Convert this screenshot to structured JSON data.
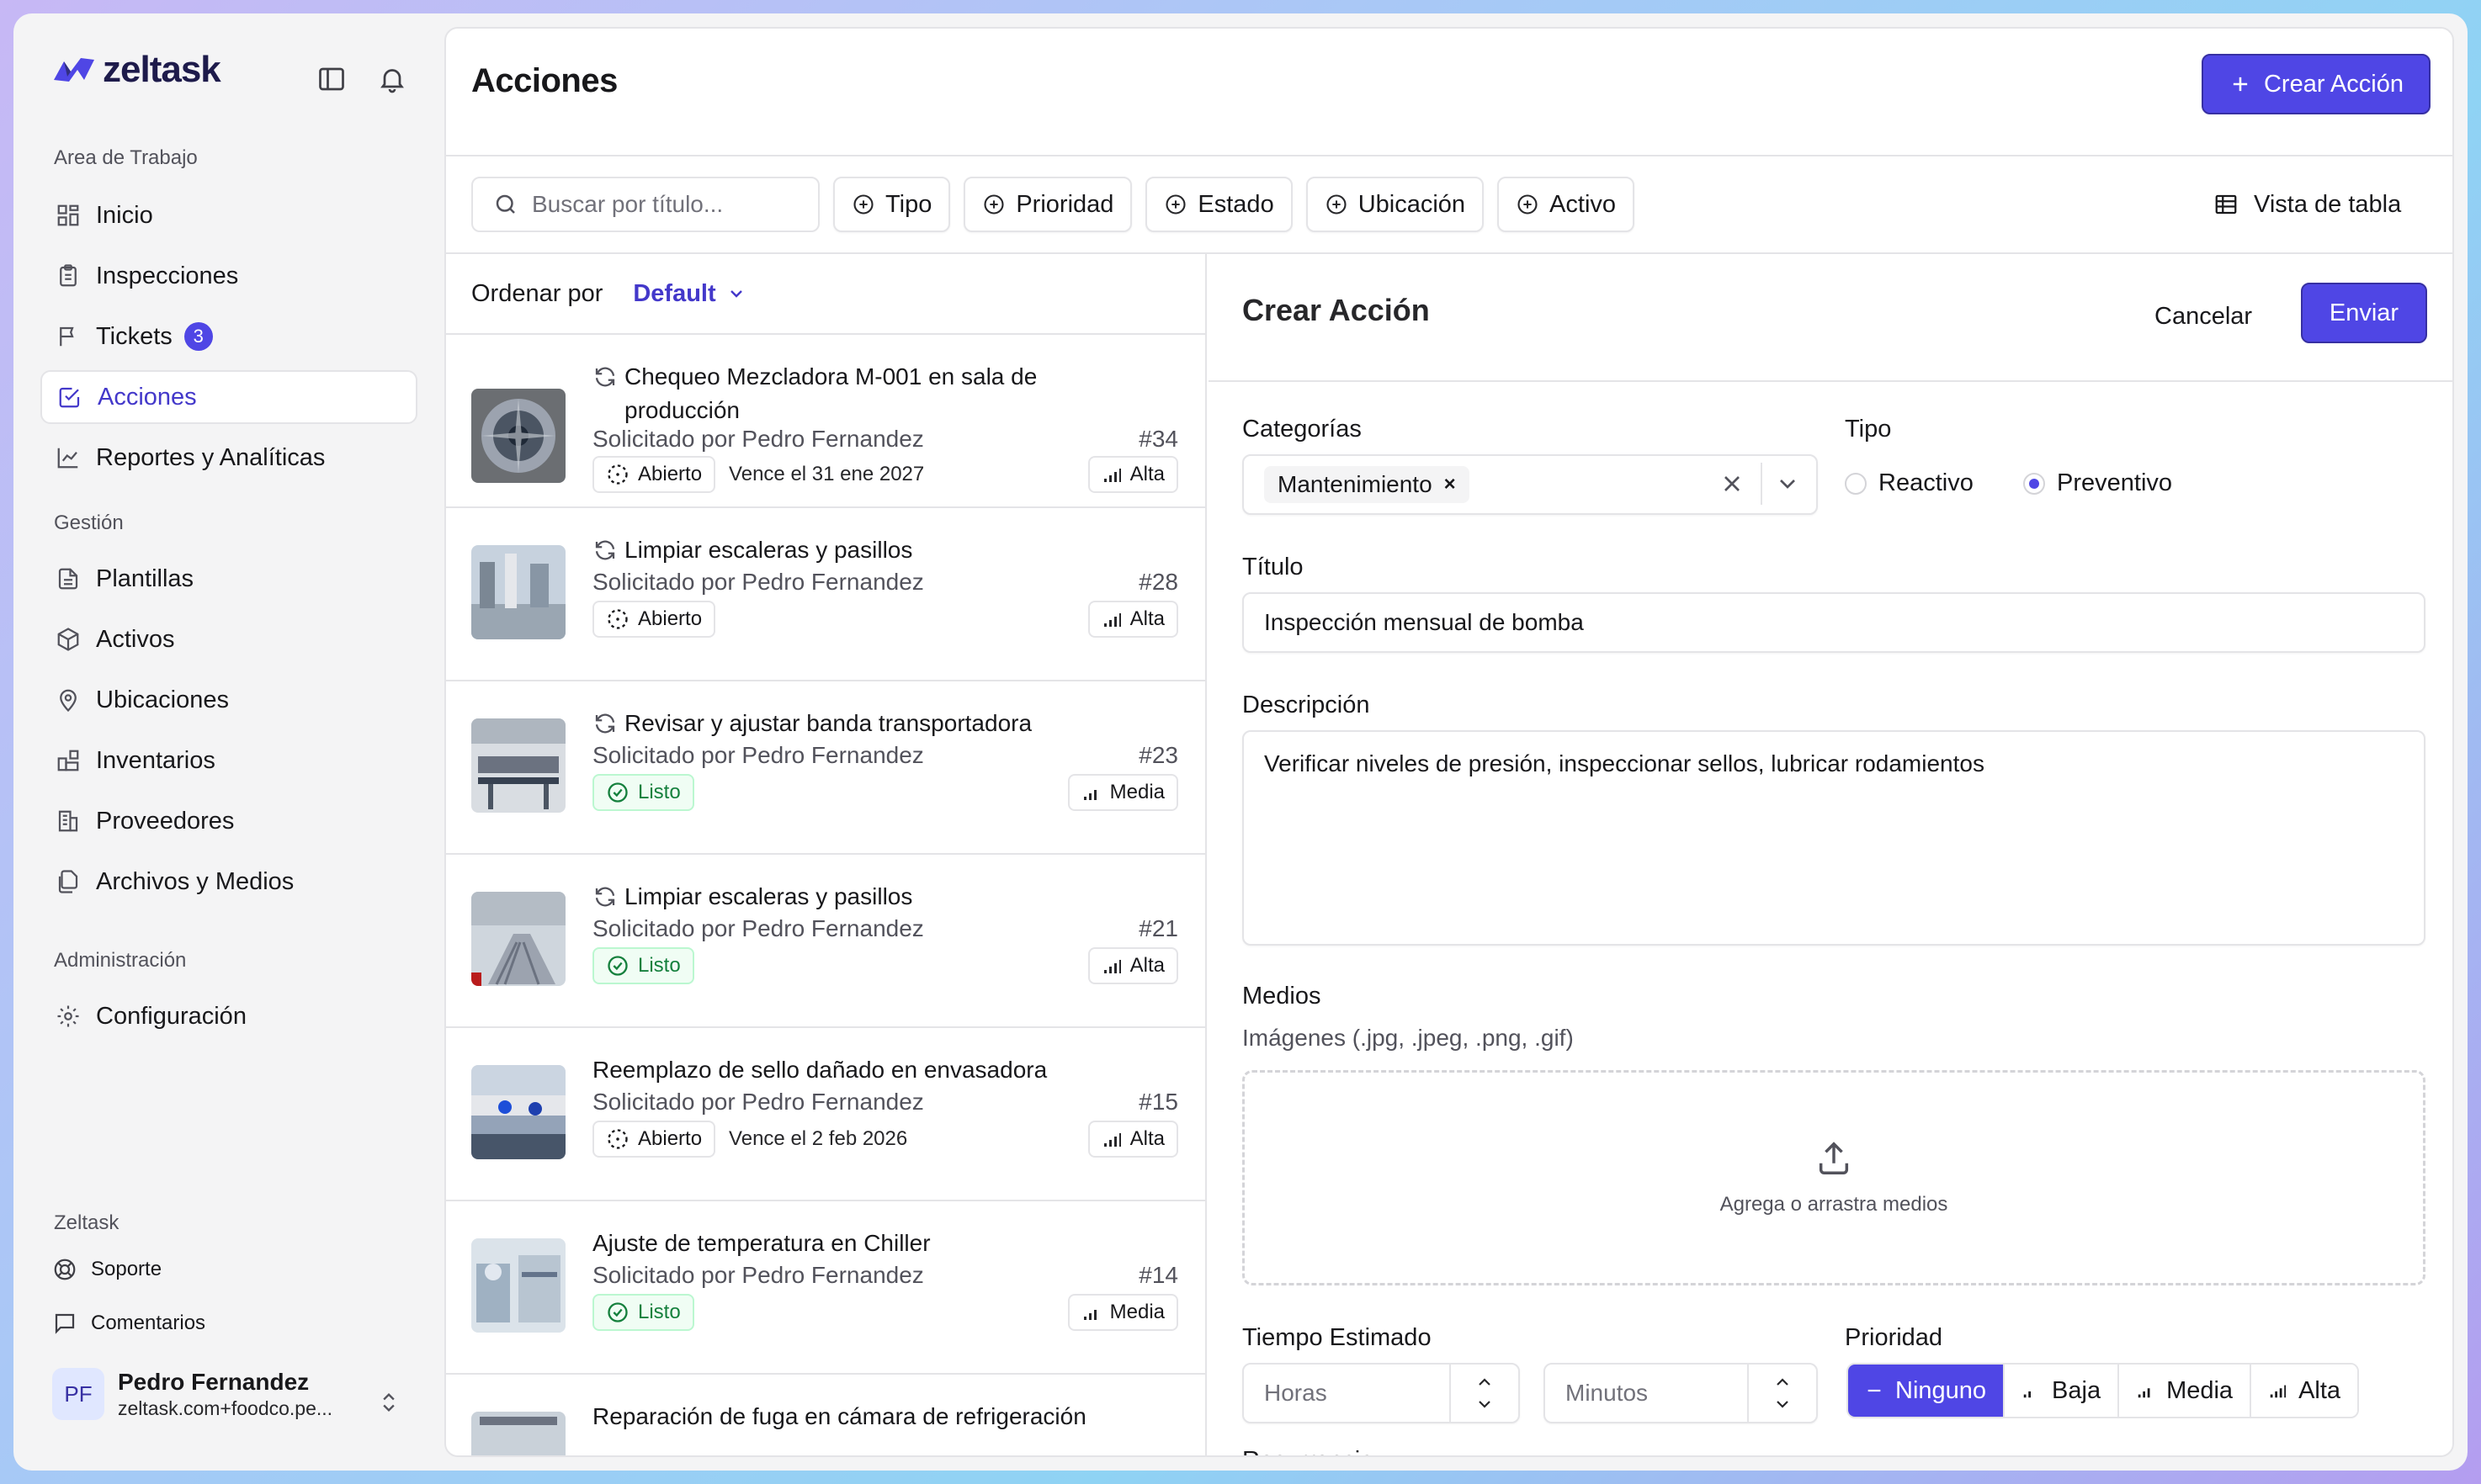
{
  "brand": {
    "name": "zeltask"
  },
  "sidebar": {
    "workspace_label": "Area de Trabajo",
    "workspace_items": [
      {
        "label": "Inicio",
        "icon": "grid-icon"
      },
      {
        "label": "Inspecciones",
        "icon": "clipboard-icon"
      },
      {
        "label": "Tickets",
        "icon": "flag-icon",
        "badge": "3"
      },
      {
        "label": "Acciones",
        "icon": "check-square-icon",
        "active": true
      },
      {
        "label": "Reportes y Analíticas",
        "icon": "chart-line-icon"
      }
    ],
    "management_label": "Gestión",
    "management_items": [
      {
        "label": "Plantillas",
        "icon": "file-icon"
      },
      {
        "label": "Activos",
        "icon": "box-icon"
      },
      {
        "label": "Ubicaciones",
        "icon": "map-pin-icon"
      },
      {
        "label": "Inventarios",
        "icon": "blocks-icon"
      },
      {
        "label": "Proveedores",
        "icon": "building-icon"
      },
      {
        "label": "Archivos y Medios",
        "icon": "files-icon"
      }
    ],
    "admin_label": "Administración",
    "admin_items": [
      {
        "label": "Configuración",
        "icon": "gear-icon"
      }
    ],
    "footer_label": "Zeltask",
    "footer_items": [
      {
        "label": "Soporte",
        "icon": "lifebuoy-icon"
      },
      {
        "label": "Comentarios",
        "icon": "message-icon"
      }
    ],
    "user": {
      "initials": "PF",
      "name": "Pedro Fernandez",
      "email": "zeltask.com+foodco.pe..."
    }
  },
  "header": {
    "title": "Acciones",
    "create_label": "Crear Acción"
  },
  "filters": {
    "search_placeholder": "Buscar por título...",
    "chips": [
      "Tipo",
      "Prioridad",
      "Estado",
      "Ubicación",
      "Activo"
    ],
    "view_label": "Vista de tabla"
  },
  "list": {
    "sort_label": "Ordenar por",
    "sort_value": "Default",
    "items": [
      {
        "title": "Chequeo Mezcladora M-001 en sala de producción",
        "recurring": true,
        "requested": "Solicitado por Pedro Fernandez",
        "number": "#34",
        "status": "Abierto",
        "status_kind": "open",
        "due": "Vence el 31 ene 2027",
        "priority": "Alta"
      },
      {
        "title": "Limpiar escaleras y pasillos",
        "recurring": true,
        "requested": "Solicitado por Pedro Fernandez",
        "number": "#28",
        "status": "Abierto",
        "status_kind": "open",
        "due": "",
        "priority": "Alta"
      },
      {
        "title": "Revisar y ajustar banda transportadora",
        "recurring": true,
        "requested": "Solicitado por Pedro Fernandez",
        "number": "#23",
        "status": "Listo",
        "status_kind": "done",
        "due": "",
        "priority": "Media"
      },
      {
        "title": "Limpiar escaleras y pasillos",
        "recurring": true,
        "requested": "Solicitado por Pedro Fernandez",
        "number": "#21",
        "status": "Listo",
        "status_kind": "done",
        "due": "",
        "priority": "Alta"
      },
      {
        "title": "Reemplazo de sello dañado en envasadora",
        "recurring": false,
        "requested": "Solicitado por Pedro Fernandez",
        "number": "#15",
        "status": "Abierto",
        "status_kind": "open",
        "due": "Vence el 2 feb 2026",
        "priority": "Alta"
      },
      {
        "title": "Ajuste de temperatura en Chiller",
        "recurring": false,
        "requested": "Solicitado por Pedro Fernandez",
        "number": "#14",
        "status": "Listo",
        "status_kind": "done",
        "due": "",
        "priority": "Media"
      },
      {
        "title": "Reparación de fuga en cámara de refrigeración",
        "recurring": false,
        "requested": "",
        "number": "",
        "status": "",
        "status_kind": "",
        "due": "",
        "priority": ""
      }
    ]
  },
  "form": {
    "title": "Crear Acción",
    "cancel_label": "Cancelar",
    "submit_label": "Enviar",
    "categories_label": "Categorías",
    "category_value": "Mantenimiento",
    "type_label": "Tipo",
    "type_options": [
      "Reactivo",
      "Preventivo"
    ],
    "type_selected": "Preventivo",
    "title_label": "Título",
    "title_value": "Inspección mensual de bomba",
    "description_label": "Descripción",
    "description_value": "Verificar niveles de presión, inspeccionar sellos, lubricar rodamientos",
    "media_label": "Medios",
    "media_help": "Imágenes (.jpg, .jpeg, .png, .gif)",
    "media_drop": "Agrega o arrastra medios",
    "estimate_label": "Tiempo Estimado",
    "hours_placeholder": "Horas",
    "minutes_placeholder": "Minutos",
    "priority_label": "Prioridad",
    "priority_options": [
      "Ninguno",
      "Baja",
      "Media",
      "Alta"
    ],
    "priority_selected": "Ninguno",
    "recurrence_label": "Recurrencia"
  },
  "colors": {
    "accent": "#4f46e5",
    "success": "#15803d"
  }
}
